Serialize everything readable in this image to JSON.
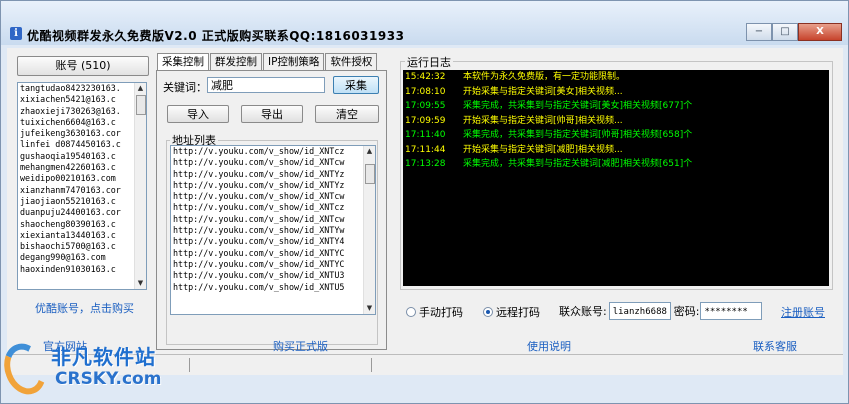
{
  "window": {
    "title": "优酷视频群发永久免费版V2.0   正式版购买联系QQ:1816031933",
    "icon_glyph": "i",
    "buttons": {
      "minimize": "−",
      "maximize": "□",
      "close": "X"
    }
  },
  "accounts": {
    "button_label": "账号 (510)",
    "items": [
      "tangtudao8423230163.",
      "xixiachen5421@163.c",
      "zhaoxieji730263@163.",
      "tuixichen6604@163.c",
      "jufeikeng3630163.cor",
      "linfei d0874450163.c",
      "gushaoqia19540163.c",
      "mehangmen42260163.c",
      "weidipo00210163.com",
      "xianzhanm7470163.cor",
      "jiaojiaon55210163.c",
      "duanpuju24400163.cor",
      "shaocheng80390163.c",
      "xiexianta13440163.c",
      "bishaochi5700@163.c",
      "degang990@163.com",
      "haoxinden91030163.c"
    ],
    "buy_link": "优酷账号，点击购买"
  },
  "tabs": [
    {
      "label": "采集控制",
      "active": true
    },
    {
      "label": "群发控制",
      "active": false
    },
    {
      "label": "IP控制策略",
      "active": false
    },
    {
      "label": "软件授权",
      "active": false
    }
  ],
  "collect": {
    "keyword_label": "关键词：",
    "keyword_value": "减肥",
    "collect_button": "采集",
    "import_button": "导入",
    "export_button": "导出",
    "clear_button": "清空",
    "address_label": "地址列表",
    "urls": [
      "http://v.youku.com/v_show/id_XNTcz",
      "http://v.youku.com/v_show/id_XNTcw",
      "http://v.youku.com/v_show/id_XNTYz",
      "http://v.youku.com/v_show/id_XNTYz",
      "http://v.youku.com/v_show/id_XNTcw",
      "http://v.youku.com/v_show/id_XNTcz",
      "http://v.youku.com/v_show/id_XNTcw",
      "http://v.youku.com/v_show/id_XNTYw",
      "http://v.youku.com/v_show/id_XNTY4",
      "http://v.youku.com/v_show/id_XNTYC",
      "http://v.youku.com/v_show/id_XNTYC",
      "http://v.youku.com/v_show/id_XNTU3",
      "http://v.youku.com/v_show/id_XNTU5"
    ]
  },
  "log": {
    "label": "运行日志",
    "entries": [
      {
        "time": "15:42:32",
        "text": "本软件为永久免费版，有一定功能限制。",
        "color": "#ffff00"
      },
      {
        "time": "17:08:10",
        "text": "开始采集与指定关键词[美女]相关视频...",
        "color": "#ffff00"
      },
      {
        "time": "17:09:55",
        "text": "采集完成，共采集到与指定关键词[美女]相关视频[677]个",
        "color": "#00ff00"
      },
      {
        "time": "17:09:59",
        "text": "开始采集与指定关键词[帅哥]相关视频...",
        "color": "#ffff00"
      },
      {
        "time": "17:11:40",
        "text": "采集完成，共采集到与指定关键词[帅哥]相关视频[658]个",
        "color": "#00ff00"
      },
      {
        "time": "17:11:44",
        "text": "开始采集与指定关键词[减肥]相关视频...",
        "color": "#ffff00"
      },
      {
        "time": "17:13:28",
        "text": "采集完成，共采集到与指定关键词[减肥]相关视频[651]个",
        "color": "#00ff00"
      }
    ]
  },
  "captcha": {
    "manual_label": "手动打码",
    "remote_label": "远程打码",
    "remote_selected": true,
    "account_label": "联众账号:",
    "account_value": "lianzh6688",
    "password_label": "密码:",
    "password_value": "********",
    "register_link": "注册账号"
  },
  "footer": {
    "website": "官方网站",
    "buy": "购买正式版",
    "manual": "使用说明",
    "support": "联系客服"
  },
  "watermark": {
    "cn": "非凡软件站",
    "en": "CRSKY.com"
  }
}
